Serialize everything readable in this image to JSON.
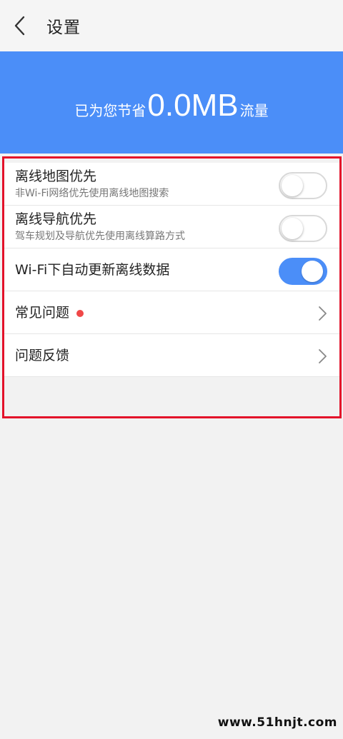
{
  "header": {
    "title": "设置",
    "back_icon": "chevron-left-icon"
  },
  "banner": {
    "prefix": "已为您节省",
    "amount": "0.0MB",
    "suffix": "流量",
    "color": "#4b8ef8"
  },
  "settings": {
    "offline_map": {
      "label": "离线地图优先",
      "sub": "非Wi-Fi网络优先使用离线地图搜索",
      "enabled": false
    },
    "offline_nav": {
      "label": "离线导航优先",
      "sub": "驾车规划及导航优先使用离线算路方式",
      "enabled": false
    },
    "wifi_update": {
      "label": "Wi-Fi下自动更新离线数据",
      "enabled": true
    },
    "faq": {
      "label": "常见问题",
      "badge_color": "#f04848"
    },
    "feedback": {
      "label": "问题反馈"
    }
  },
  "watermark": "www.51hnjt.com",
  "colors": {
    "accent": "#4b8ef8",
    "highlight": "#e3122a"
  }
}
